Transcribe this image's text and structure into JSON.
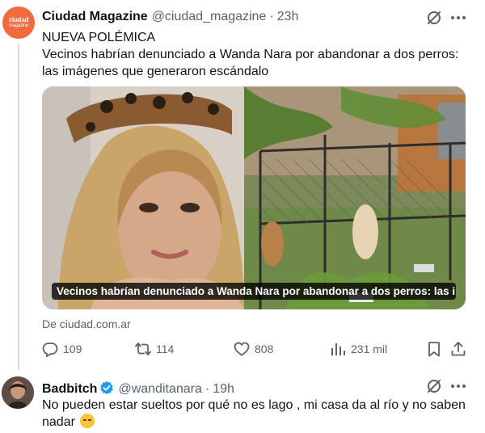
{
  "colors": {
    "accent": "#1d9bf0",
    "brand_avatar": "#f26a3e",
    "muted": "#536471",
    "text": "#0f1419",
    "thread_line": "#cfd9de"
  },
  "main_tweet": {
    "avatar_line1": "ciudad",
    "avatar_line2": "magazine",
    "author_name": "Ciudad Magazine",
    "author_handle": "@ciudad_magazine",
    "separator": "·",
    "time": "23h",
    "tag_text": "NUEVA POLÉMICA",
    "text": "Vecinos habrían denunciado a Wanda Nara por abandonar a dos perros: las imágenes que generaron escándalo",
    "card_caption": "Vecinos habrían denunciado a Wanda Nara por abandonar a dos perros: las im...",
    "card_source": "De ciudad.com.ar",
    "actions": {
      "replies": "109",
      "retweets": "114",
      "likes": "808",
      "views": "231 mil"
    },
    "icons": [
      "grok-icon",
      "more-icon",
      "reply-icon",
      "retweet-icon",
      "like-icon",
      "views-icon",
      "bookmark-icon",
      "share-icon"
    ]
  },
  "reply_tweet": {
    "author_name": "Badbitch",
    "author_handle": "@wanditanara",
    "separator": "·",
    "time": "19h",
    "text": "No pueden estar sueltos por qué no es lago , mi casa da al río y no saben nadar",
    "emoji": "relieved-face-emoji",
    "icons": [
      "verified-badge-icon",
      "grok-icon",
      "more-icon"
    ]
  }
}
